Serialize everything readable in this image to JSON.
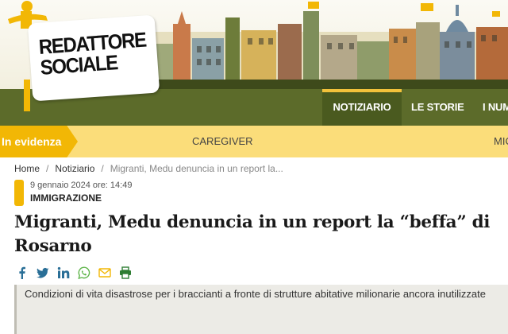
{
  "logo": {
    "text_line1": "REDATTORE",
    "text_line2": "SOCIALE"
  },
  "nav": {
    "items": [
      {
        "label": "NOTIZIARIO"
      },
      {
        "label": "LE STORIE"
      },
      {
        "label": "I NUM"
      }
    ]
  },
  "evidenza": {
    "label": "In evidenza",
    "links": [
      "CAREGIVER",
      "MIC"
    ]
  },
  "breadcrumb": {
    "home": "Home",
    "section": "Notiziario",
    "current": "Migranti, Medu denuncia in un report la..."
  },
  "article": {
    "datetime": "9 gennaio 2024 ore: 14:49",
    "category": "IMMIGRAZIONE",
    "title": "Migranti, Medu denuncia in un report la “beffa” di Rosarno",
    "subtitle": "Condizioni di vita disastrose per i braccianti a fronte di strutture abitative milionarie ancora inutilizzate"
  },
  "share": {
    "icons": [
      "facebook-icon",
      "twitter-icon",
      "linkedin-icon",
      "whatsapp-icon",
      "email-icon",
      "print-icon"
    ]
  },
  "colors": {
    "nav_green": "#5c6b2a",
    "accent_yellow": "#f2b705",
    "evidenza_bg": "#fbdd7a",
    "share_icon": "#2a6f97"
  }
}
